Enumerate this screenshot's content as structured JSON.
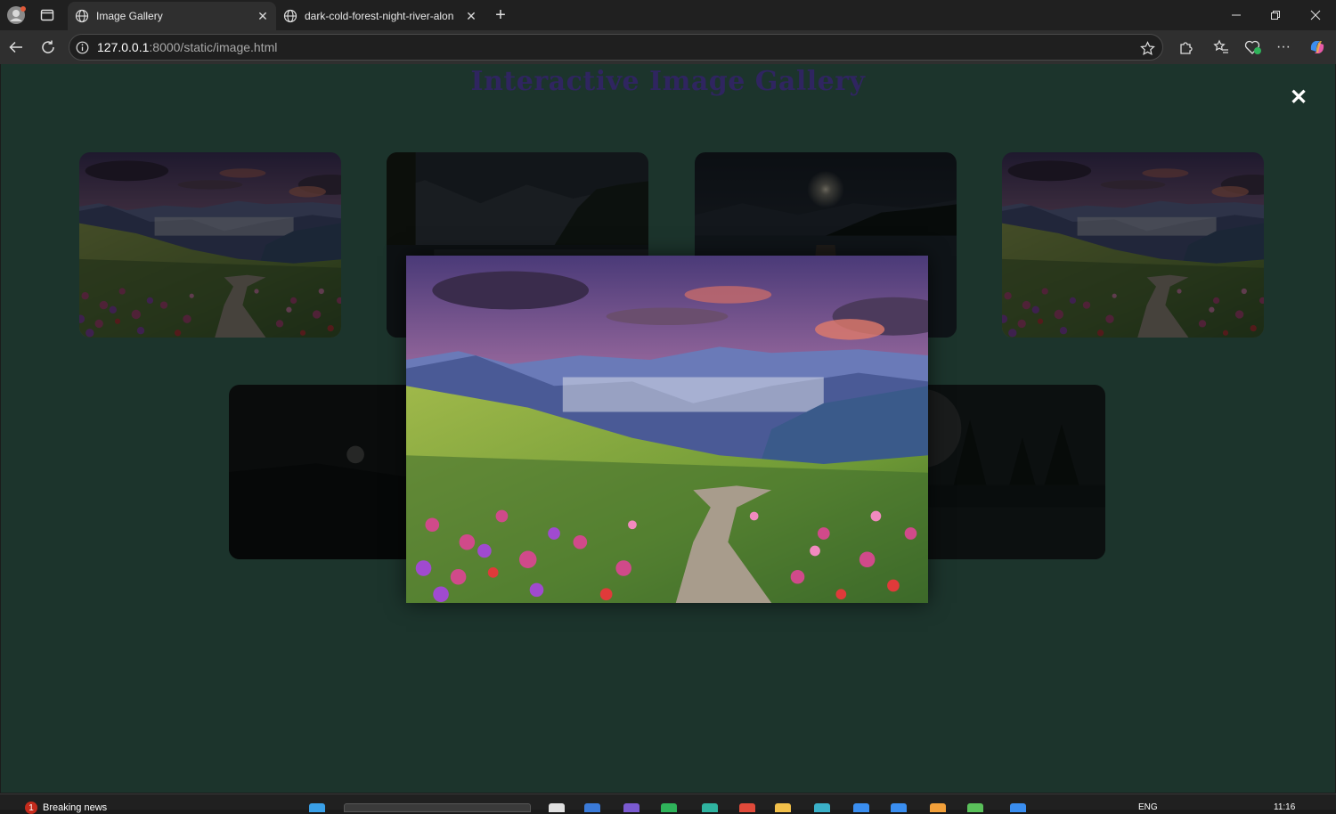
{
  "browser": {
    "tabs": [
      {
        "title": "Image Gallery",
        "active": true
      },
      {
        "title": "dark-cold-forest-night-river-alon",
        "active": false
      }
    ],
    "address": {
      "host": "127.0.0.1",
      "path": ":8000/static/image.html"
    }
  },
  "page": {
    "title": "Interactive Image Gallery",
    "background": "#1c342c",
    "gallery": [
      {
        "scene": "flower-meadow-sunset"
      },
      {
        "scene": "dark-forest-lake"
      },
      {
        "scene": "moonlit-lake-dock"
      },
      {
        "scene": "flower-meadow-sunset"
      },
      {
        "scene": "dark-night-hills-moon"
      },
      {
        "scene": "night-forest-full-moon"
      }
    ],
    "lightbox": {
      "scene": "flower-meadow-sunset",
      "close_label": "✕"
    }
  },
  "taskbar": {
    "news_count": "1",
    "news_label": "Breaking news",
    "language": "ENG",
    "time": "11:16"
  }
}
